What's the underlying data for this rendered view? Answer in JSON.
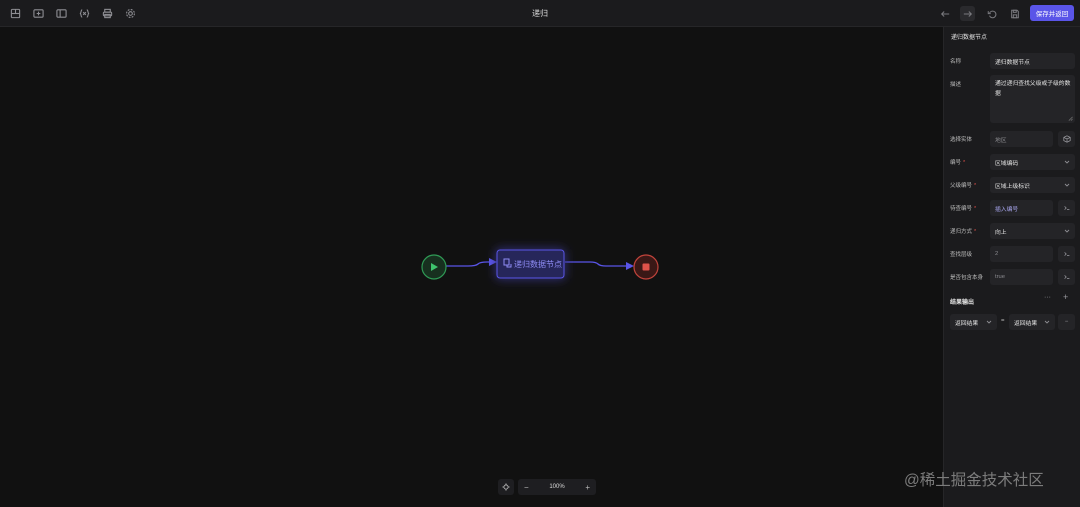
{
  "app": {
    "title": "递归",
    "save_button": "保存并返回"
  },
  "toolbar": {
    "left_icons": [
      "layout-icon",
      "import-icon",
      "panel-icon",
      "variable-icon",
      "print-icon",
      "settings-icon"
    ],
    "right_icons": [
      "undo-arrow-icon",
      "redo-arrow-icon",
      "revert-icon",
      "save-icon"
    ]
  },
  "canvas": {
    "start_node": {
      "icon": "play-icon",
      "color": "#3ec46d"
    },
    "recursion_node": {
      "label": "递归数据节点",
      "icon": "recursion-node-icon",
      "color": "#5a55e8"
    },
    "end_node": {
      "icon": "stop-icon",
      "color": "#e0524a"
    },
    "zoom": {
      "level": "100%",
      "minus": "−",
      "plus": "+"
    }
  },
  "panel": {
    "title": "递归数据节点",
    "name": {
      "label": "名称",
      "value": "递归数据节点"
    },
    "description": {
      "label": "描述",
      "value": "通过递归查找父级或子级的数据"
    },
    "entity": {
      "label": "选择实体",
      "value": "地区"
    },
    "code": {
      "label": "编号",
      "value": "区域编码"
    },
    "parent_code": {
      "label": "父级编号",
      "value": "区域上级标识"
    },
    "target_code": {
      "label": "待查编号",
      "placeholder": "插入编号"
    },
    "mode": {
      "label": "递归方式",
      "value": "向上"
    },
    "depth": {
      "label": "查找层级",
      "value": "2"
    },
    "include_self": {
      "label": "是否包含本身",
      "value": "true"
    },
    "output": {
      "title": "结果输出",
      "more": "···",
      "add": "+",
      "left": "返回结果",
      "equals": "=",
      "right": "返回结果",
      "remove": "−"
    }
  },
  "watermark": "@稀土掘金技术社区"
}
